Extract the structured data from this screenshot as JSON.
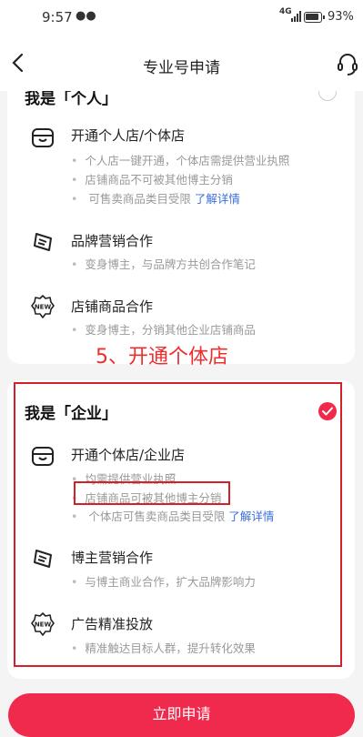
{
  "status_bar": {
    "time": "9:57",
    "network": "4G",
    "battery": "93%"
  },
  "header": {
    "title": "专业号申请"
  },
  "personal": {
    "title": "我是「个人」",
    "features": [
      {
        "icon": "shop-icon",
        "title": "开通个人店/个体店",
        "bullets": [
          "个人店一键开通，个体店需提供营业执照",
          "店铺商品不可被其他博主分销",
          "可售卖商品类目受限"
        ],
        "link": "了解详情"
      },
      {
        "icon": "brand-tag-icon",
        "title": "品牌营销合作",
        "bullets": [
          "变身博主，与品牌方共创合作笔记"
        ]
      },
      {
        "icon": "new-badge-icon",
        "title": "店铺商品合作",
        "bullets": [
          "变身博主，分销其他企业店铺商品"
        ]
      }
    ]
  },
  "annotation": {
    "text": "5、开通个体店"
  },
  "enterprise": {
    "title": "我是「企业」",
    "features": [
      {
        "icon": "shop-icon",
        "title": "开通个体店/企业店",
        "bullets": [
          "均需提供营业执照",
          "店铺商品可被其他博主分销",
          "个体店可售卖商品类目受限"
        ],
        "link": "了解详情"
      },
      {
        "icon": "brand-tag-icon",
        "title": "博主营销合作",
        "bullets": [
          "与博主商业合作，扩大品牌影响力"
        ]
      },
      {
        "icon": "new-badge-icon",
        "title": "广告精准投放",
        "bullets": [
          "精准触达目标人群，提升转化效果"
        ]
      }
    ]
  },
  "submit_button": "立即申请",
  "colors": {
    "accent": "#f02a4c",
    "link": "#3a6fd8",
    "annotation": "#ee2d2d"
  }
}
